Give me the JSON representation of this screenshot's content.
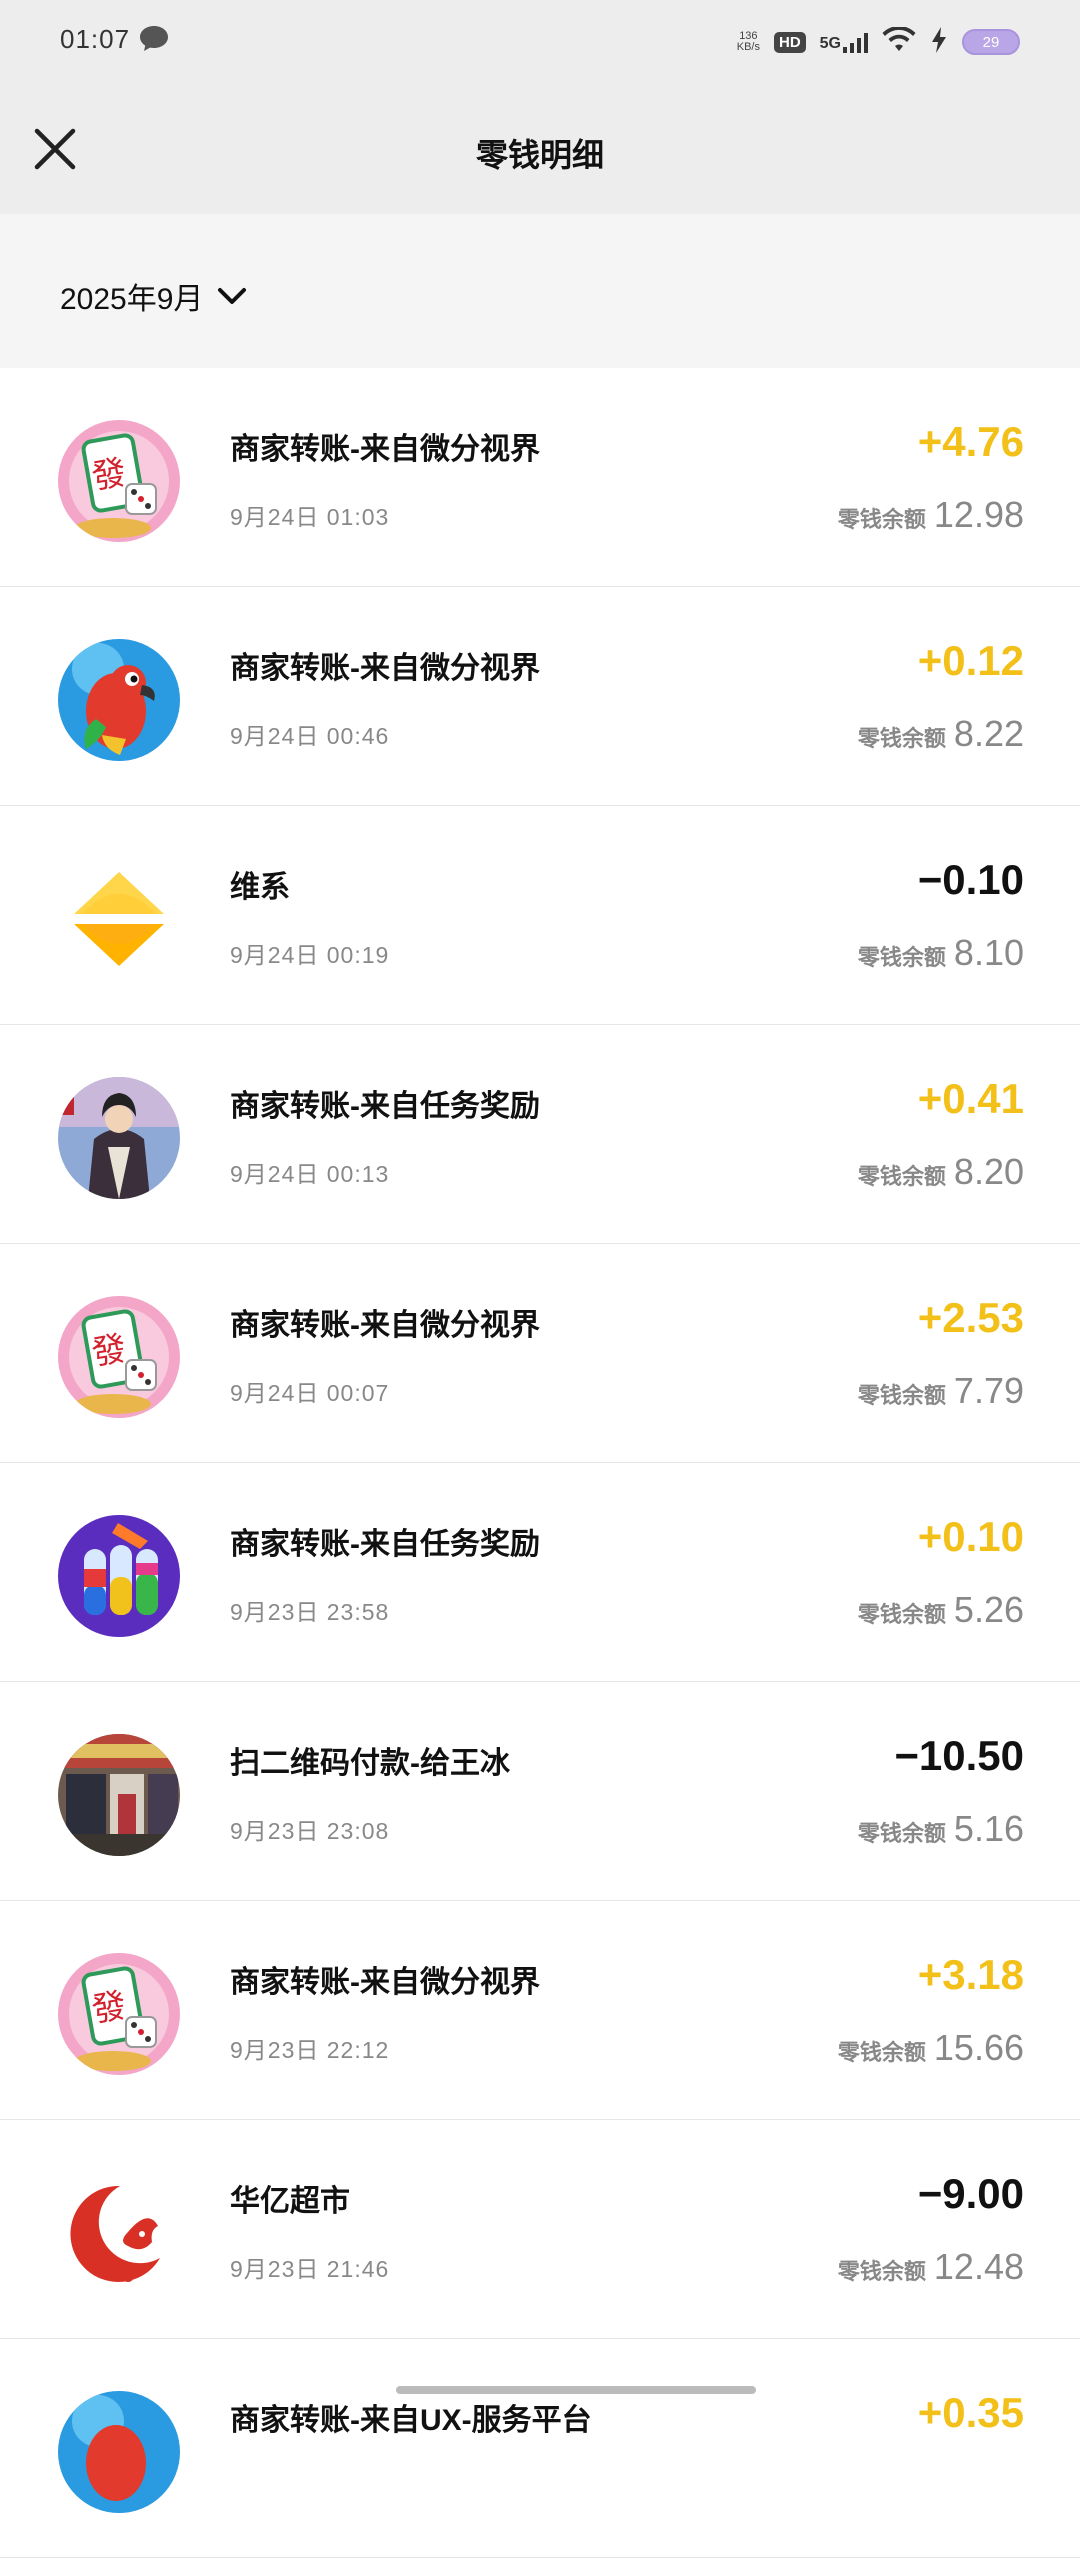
{
  "status_bar": {
    "time": "01:07",
    "net_speed_value": "136",
    "net_speed_unit": "KB/s",
    "hd": "HD",
    "network": "5G",
    "battery": "29"
  },
  "header": {
    "title": "零钱明细",
    "close_icon": "close-icon"
  },
  "filter": {
    "month": "2025年9月"
  },
  "transactions": [
    {
      "title": "商家转账-来自微分视界",
      "time": "9月24日 01:03",
      "amount": "+4.76",
      "balance_label": "零钱余额",
      "balance": "12.98",
      "icon": "mahjong-icon"
    },
    {
      "title": "商家转账-来自微分视界",
      "time": "9月24日 00:46",
      "amount": "+0.12",
      "balance_label": "零钱余额",
      "balance": "8.22",
      "icon": "parrot-icon"
    },
    {
      "title": "维系",
      "time": "9月24日 00:19",
      "amount": "−0.10",
      "balance_label": "零钱余额",
      "balance": "8.10",
      "icon": "weixi-logo-icon"
    },
    {
      "title": "商家转账-来自任务奖励",
      "time": "9月24日 00:13",
      "amount": "+0.41",
      "balance_label": "零钱余额",
      "balance": "8.20",
      "icon": "character-icon"
    },
    {
      "title": "商家转账-来自微分视界",
      "time": "9月24日 00:07",
      "amount": "+2.53",
      "balance_label": "零钱余额",
      "balance": "7.79",
      "icon": "mahjong-icon"
    },
    {
      "title": "商家转账-来自任务奖励",
      "time": "9月23日 23:58",
      "amount": "+0.10",
      "balance_label": "零钱余额",
      "balance": "5.26",
      "icon": "color-bottles-icon"
    },
    {
      "title": "扫二维码付款-给王冰",
      "time": "9月23日 23:08",
      "amount": "−10.50",
      "balance_label": "零钱余额",
      "balance": "5.16",
      "icon": "shopfront-photo-icon"
    },
    {
      "title": "商家转账-来自微分视界",
      "time": "9月23日 22:12",
      "amount": "+3.18",
      "balance_label": "零钱余额",
      "balance": "15.66",
      "icon": "mahjong-icon"
    },
    {
      "title": "华亿超市",
      "time": "9月23日 21:46",
      "amount": "−9.00",
      "balance_label": "零钱余额",
      "balance": "12.48",
      "icon": "supermarket-logo-icon"
    },
    {
      "title": "商家转账-来自UX-服务平台",
      "time": "",
      "amount": "+0.35",
      "balance_label": "",
      "balance": "",
      "icon": "parrot-icon"
    }
  ],
  "colors": {
    "positive": "#f2c019",
    "negative": "#111111",
    "header_bg": "#ededed",
    "filter_bg": "#f5f5f5"
  }
}
